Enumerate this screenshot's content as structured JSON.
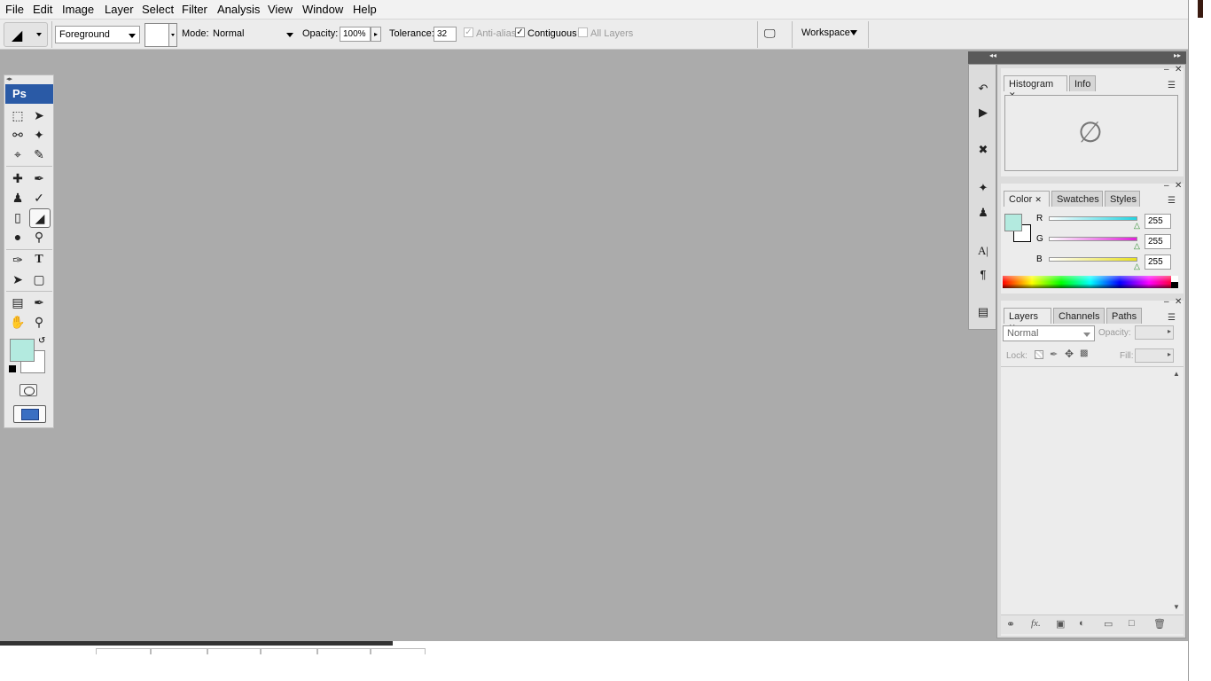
{
  "menubar": {
    "items": [
      "File",
      "Edit",
      "Image",
      "Layer",
      "Select",
      "Filter",
      "Analysis",
      "View",
      "Window",
      "Help"
    ]
  },
  "options": {
    "fill_source": "Foreground",
    "mode_label": "Mode:",
    "mode_value": "Normal",
    "opacity_label": "Opacity:",
    "opacity_value": "100%",
    "tolerance_label": "Tolerance:",
    "tolerance_value": "32",
    "antialias_label": "Anti-alias",
    "contiguous_label": "Contiguous",
    "all_layers_label": "All Layers",
    "workspace_label": "Workspace"
  },
  "toolbox": {
    "logo": "Ps",
    "foreground_color": "#b3eadf",
    "background_color": "#ffffff"
  },
  "histogram_panel": {
    "tabs": [
      "Histogram",
      "Info"
    ],
    "empty_symbol": "∅"
  },
  "color_panel": {
    "tabs": [
      "Color",
      "Swatches",
      "Styles"
    ],
    "swatch_color": "#b3eadf",
    "channels": [
      {
        "label": "R",
        "value": "255",
        "color": "#22d3e0"
      },
      {
        "label": "G",
        "value": "255",
        "color": "#e020d8"
      },
      {
        "label": "B",
        "value": "255",
        "color": "#e8e020"
      }
    ]
  },
  "layers_panel": {
    "tabs": [
      "Layers",
      "Channels",
      "Paths"
    ],
    "blend_mode": "Normal",
    "opacity_label": "Opacity:",
    "lock_label": "Lock:",
    "fill_label": "Fill:"
  }
}
